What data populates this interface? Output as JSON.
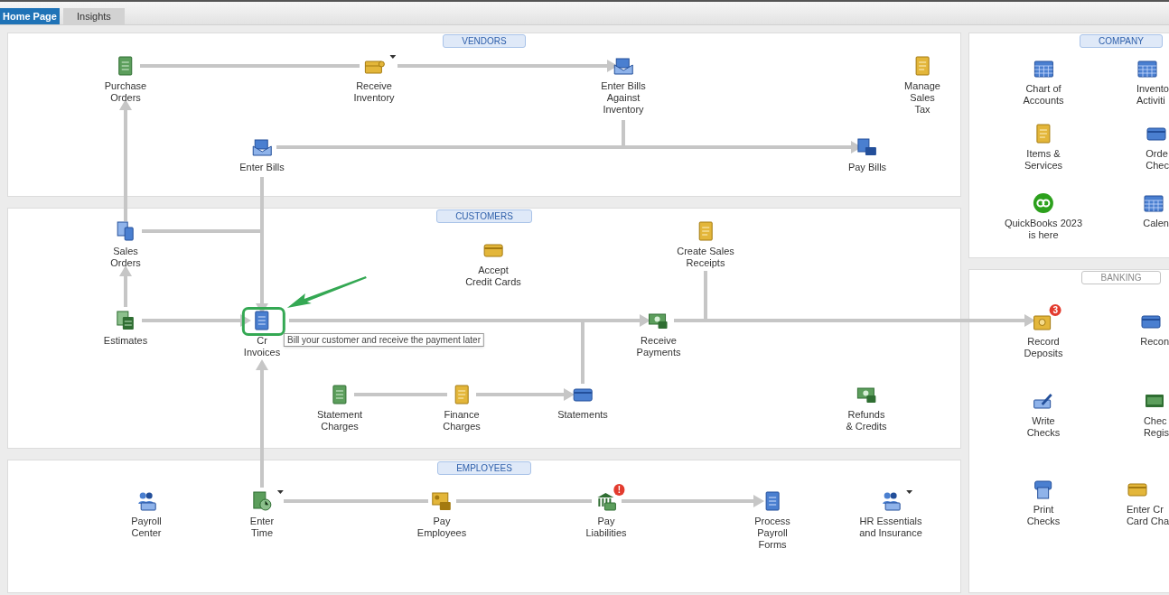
{
  "tabs": [
    {
      "label": "Home Page",
      "selected": true
    },
    {
      "label": "Insights",
      "selected": false
    }
  ],
  "sections": [
    {
      "title": "VENDORS",
      "highlighted": true,
      "items": [
        {
          "lines": [
            "Purchase",
            "Orders"
          ],
          "menu": false,
          "highlighted": false
        },
        {
          "lines": [
            "Receive",
            "Inventory"
          ],
          "menu": true,
          "highlighted": false
        },
        {
          "lines": [
            "Enter Bills",
            "Against",
            "Inventory"
          ],
          "menu": false,
          "highlighted": false
        },
        {
          "lines": [
            "Manage",
            "Sales",
            "Tax"
          ],
          "menu": false,
          "highlighted": false
        },
        {
          "lines": [
            "Enter Bills"
          ],
          "menu": false,
          "highlighted": false
        },
        {
          "lines": [
            "Pay Bills"
          ],
          "menu": false,
          "highlighted": false
        }
      ]
    },
    {
      "title": "CUSTOMERS",
      "highlighted": true,
      "items": [
        {
          "lines": [
            "Sales",
            "Orders"
          ],
          "menu": false,
          "highlighted": false
        },
        {
          "lines": [
            "Accept",
            "Credit Cards"
          ],
          "menu": false,
          "highlighted": false
        },
        {
          "lines": [
            "Create Sales",
            "Receipts"
          ],
          "menu": false,
          "highlighted": false
        },
        {
          "lines": [
            "Estimates"
          ],
          "menu": false,
          "highlighted": false
        },
        {
          "lines": [
            "Cr",
            "Invoices"
          ],
          "menu": false,
          "highlighted": true,
          "tooltip": "Bill your customer and receive the payment later"
        },
        {
          "lines": [
            "Receive",
            "Payments"
          ],
          "menu": false,
          "highlighted": false
        },
        {
          "lines": [
            "Statement",
            "Charges"
          ],
          "menu": false,
          "highlighted": false
        },
        {
          "lines": [
            "Finance",
            "Charges"
          ],
          "menu": false,
          "highlighted": false
        },
        {
          "lines": [
            "Statements"
          ],
          "menu": false,
          "highlighted": false
        },
        {
          "lines": [
            "Refunds",
            "& Credits"
          ],
          "menu": false,
          "highlighted": false
        }
      ]
    },
    {
      "title": "EMPLOYEES",
      "highlighted": true,
      "items": [
        {
          "lines": [
            "Payroll",
            "Center"
          ],
          "menu": false,
          "highlighted": false
        },
        {
          "lines": [
            "Enter",
            "Time"
          ],
          "menu": true,
          "highlighted": false
        },
        {
          "lines": [
            "Pay",
            "Employees"
          ],
          "menu": false,
          "highlighted": false
        },
        {
          "lines": [
            "Pay",
            "Liabilities"
          ],
          "menu": false,
          "highlighted": false,
          "badge": "!"
        },
        {
          "lines": [
            "Process",
            "Payroll",
            "Forms"
          ],
          "menu": false,
          "highlighted": false
        },
        {
          "lines": [
            "HR Essentials",
            "and Insurance"
          ],
          "menu": true,
          "highlighted": false
        }
      ]
    },
    {
      "title": "COMPANY",
      "highlighted": true,
      "items": [
        {
          "lines": [
            "Chart of",
            "Accounts"
          ],
          "menu": false,
          "highlighted": false
        },
        {
          "lines": [
            "Invento",
            "Activiti"
          ],
          "menu": false,
          "highlighted": false
        },
        {
          "lines": [
            "Items &",
            "Services"
          ],
          "menu": false,
          "highlighted": false
        },
        {
          "lines": [
            "Orde",
            "Chec"
          ],
          "menu": false,
          "highlighted": false
        },
        {
          "lines": [
            "QuickBooks 2023",
            "is here"
          ],
          "menu": false,
          "highlighted": false
        },
        {
          "lines": [
            "Calen"
          ],
          "menu": false,
          "highlighted": false
        }
      ]
    },
    {
      "title": "BANKING",
      "highlighted": false,
      "items": [
        {
          "lines": [
            "Record",
            "Deposits"
          ],
          "menu": false,
          "highlighted": false,
          "badge": "3"
        },
        {
          "lines": [
            "Recon"
          ],
          "menu": false,
          "highlighted": false
        },
        {
          "lines": [
            "Write",
            "Checks"
          ],
          "menu": false,
          "highlighted": false
        },
        {
          "lines": [
            "Chec",
            "Regis"
          ],
          "menu": false,
          "highlighted": false
        },
        {
          "lines": [
            "Print",
            "Checks"
          ],
          "menu": false,
          "highlighted": false
        },
        {
          "lines": [
            "Enter Cr",
            "Card Cha"
          ],
          "menu": false,
          "highlighted": false
        }
      ]
    }
  ]
}
